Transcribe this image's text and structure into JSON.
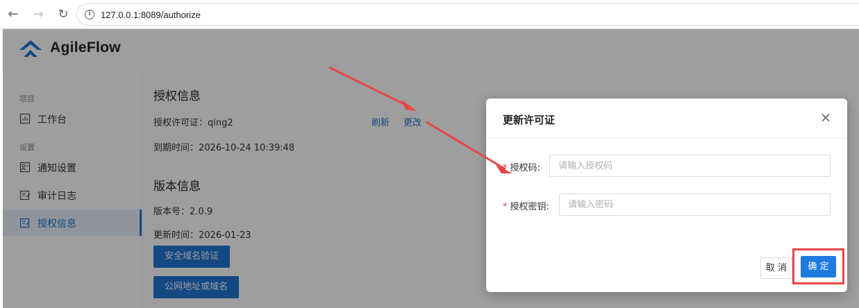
{
  "browser": {
    "url": "127.0.0.1:8089/authorize",
    "back": "←",
    "forward": "→",
    "reload": "↻"
  },
  "app": {
    "brand": "AgileFlow",
    "sidebar": {
      "groups": [
        {
          "label": "项目",
          "items": [
            {
              "label": "工作台",
              "icon": "dashboard-icon"
            }
          ]
        },
        {
          "label": "设置",
          "items": [
            {
              "label": "通知设置",
              "icon": "notify-icon"
            },
            {
              "label": "审计日志",
              "icon": "audit-icon"
            },
            {
              "label": "授权信息",
              "icon": "license-icon",
              "active": true
            }
          ]
        }
      ]
    },
    "auth_section": {
      "title": "授权信息",
      "license_label": "授权许可证：",
      "license_value": "qing2",
      "refresh": "刷新",
      "change": "更改",
      "expire_label": "到期时间：",
      "expire_value": "2026-10-24 10:39:48"
    },
    "version_section": {
      "title": "版本信息",
      "version_label": "版本号：",
      "version_value": "2.0.9",
      "update_label": "更新时间：",
      "update_value": "2026-01-23",
      "btn_domain": "安全域名验证",
      "btn_public": "公网地址或域名"
    }
  },
  "modal": {
    "title": "更新许可证",
    "close": "×",
    "required_mark": "*",
    "code_label": "授权码:",
    "code_placeholder": "请输入授权码",
    "code_value": "",
    "secret_label": "授权密钥:",
    "secret_placeholder": "请输入密码",
    "secret_value": "",
    "cancel": "取 消",
    "ok": "确 定"
  },
  "colors": {
    "primary": "#1f74d3",
    "annotation": "#e84545",
    "required": "#e53935"
  }
}
